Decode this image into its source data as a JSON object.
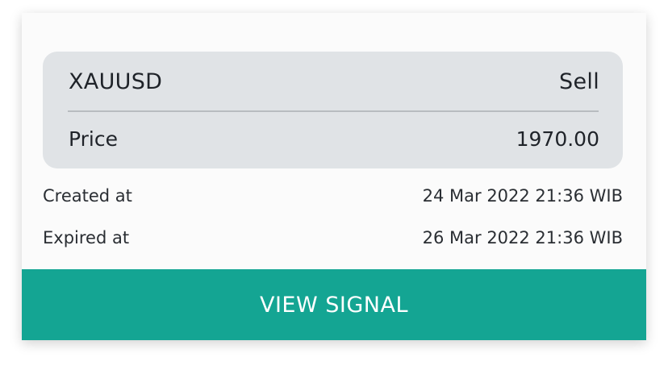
{
  "signal": {
    "symbol": "XAUUSD",
    "action": "Sell",
    "price_label": "Price",
    "price_value": "1970.00"
  },
  "meta": {
    "created_label": "Created at",
    "created_value": "24 Mar 2022 21:36 WIB",
    "expired_label": "Expired at",
    "expired_value": "26 Mar 2022 21:36 WIB"
  },
  "button": {
    "label": "VIEW SIGNAL"
  },
  "colors": {
    "accent": "#14a593",
    "panel_bg": "#e0e3e6",
    "card_bg": "#fbfbfb",
    "text": "#1f2329"
  }
}
